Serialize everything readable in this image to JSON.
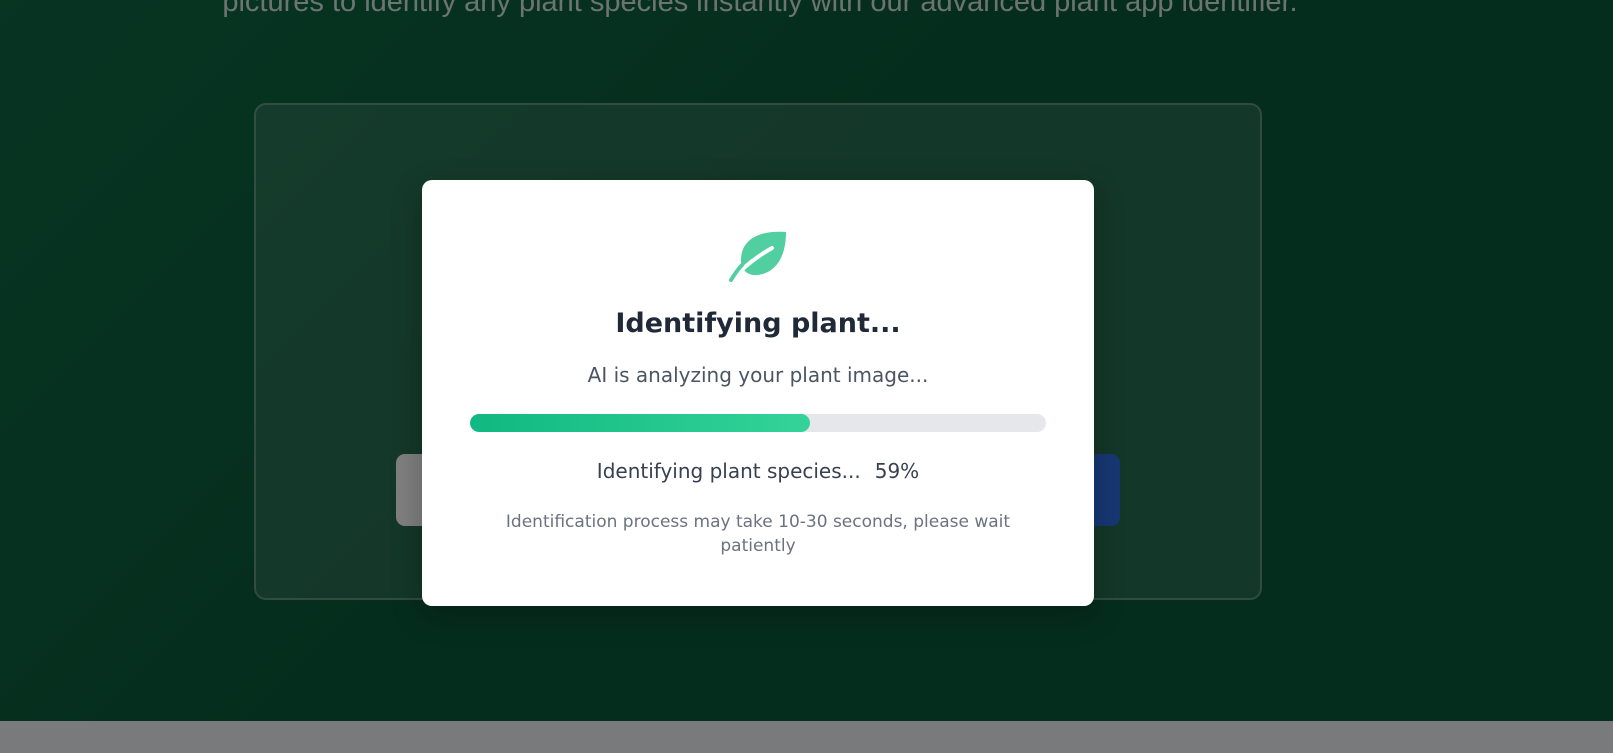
{
  "hero": {
    "subtitle": "pictures to identify any plant species instantly with our advanced plant app identifier."
  },
  "modal": {
    "icon": "leaf-icon",
    "title": "Identifying plant...",
    "subtitle": "AI is analyzing your plant image...",
    "progress": {
      "fraction": 0.59,
      "status_text": "Identifying plant species...",
      "percent_text": "59%"
    },
    "note": "Identification process may take 10-30 seconds, please wait patiently"
  },
  "colors": {
    "accent": "#10b981",
    "accent_light": "#34d399",
    "hero_bg": "#0b5a3c",
    "title": "#1f2937"
  }
}
